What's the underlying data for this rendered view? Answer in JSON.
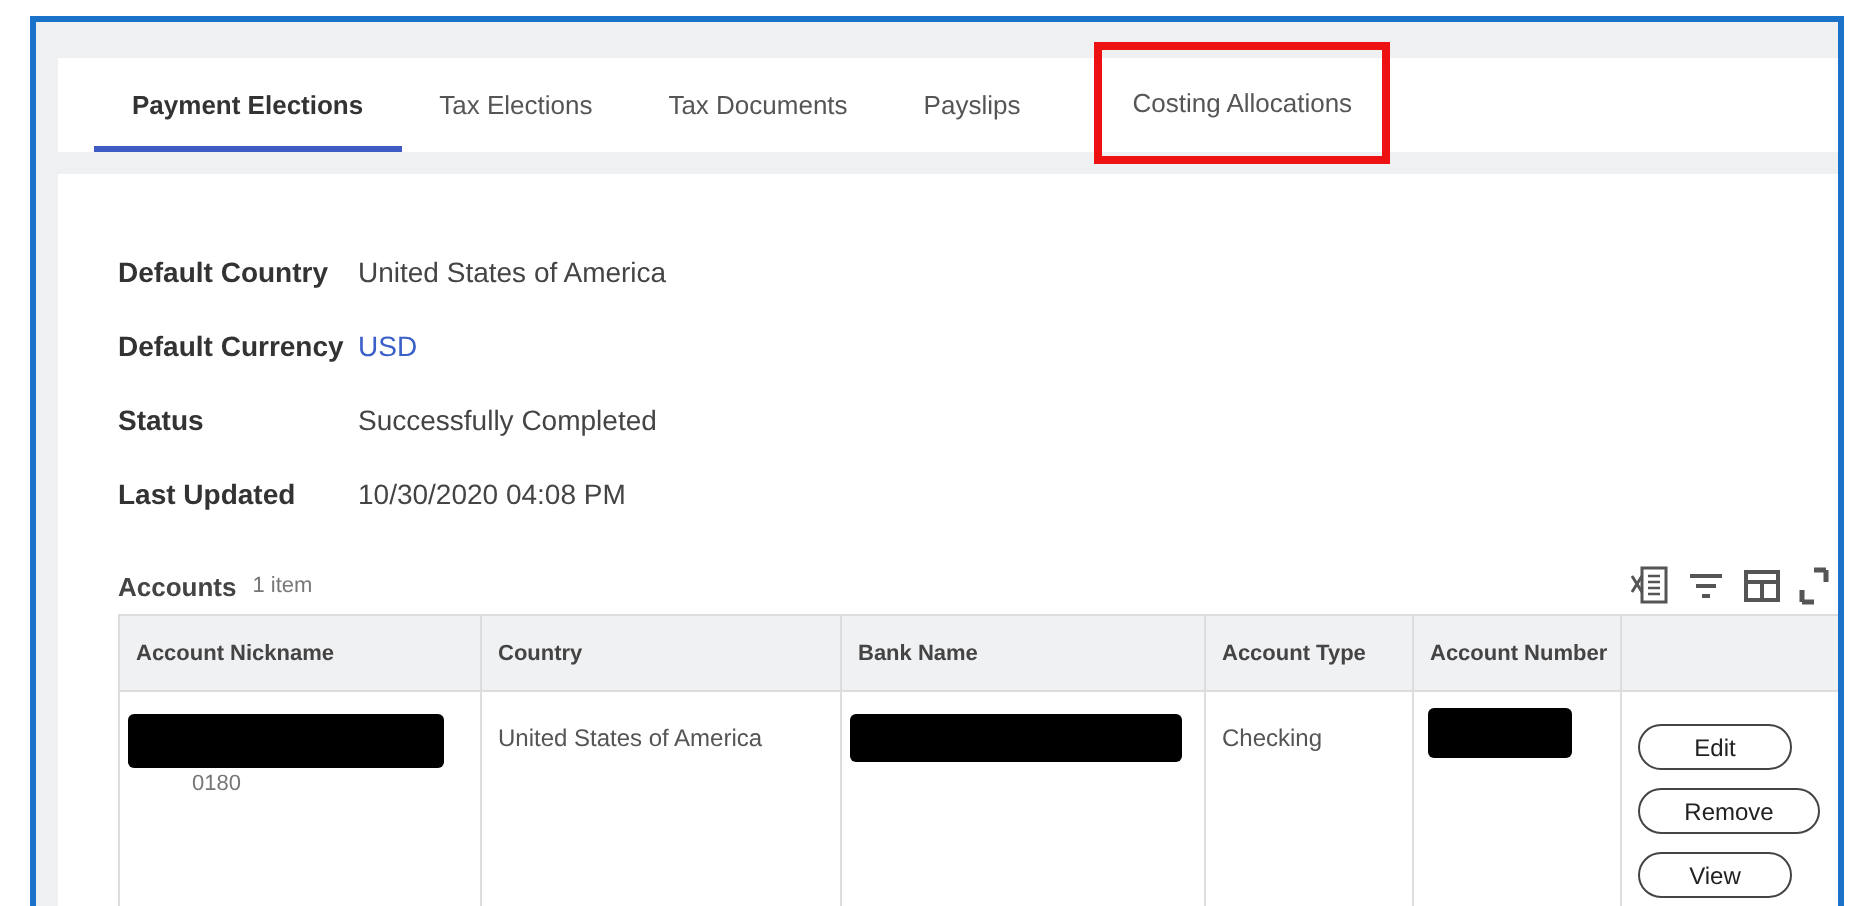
{
  "tabs": [
    {
      "label": "Payment Elections",
      "selected": true,
      "highlighted": false
    },
    {
      "label": "Tax Elections",
      "selected": false,
      "highlighted": false
    },
    {
      "label": "Tax Documents",
      "selected": false,
      "highlighted": false
    },
    {
      "label": "Payslips",
      "selected": false,
      "highlighted": false
    },
    {
      "label": "Costing Allocations",
      "selected": false,
      "highlighted": true
    }
  ],
  "details": [
    {
      "label": "Default Country",
      "value": "United States of America",
      "kind": "text"
    },
    {
      "label": "Default Currency",
      "value": "USD",
      "kind": "link"
    },
    {
      "label": "Status",
      "value": "Successfully Completed",
      "kind": "text"
    },
    {
      "label": "Last Updated",
      "value": "10/30/2020 04:08 PM",
      "kind": "text"
    }
  ],
  "accounts": {
    "title": "Accounts",
    "count": "1 item",
    "columns": [
      "Account Nickname",
      "Country",
      "Bank Name",
      "Account Type",
      "Account Number"
    ],
    "rows": [
      {
        "nickname": {
          "redacted": true,
          "visible_fragment": "0180"
        },
        "country": "United States of America",
        "bank_name": {
          "redacted": true
        },
        "account_type": "Checking",
        "account_number": {
          "redacted": true
        },
        "actions": [
          "Edit",
          "Remove",
          "View"
        ]
      }
    ]
  }
}
